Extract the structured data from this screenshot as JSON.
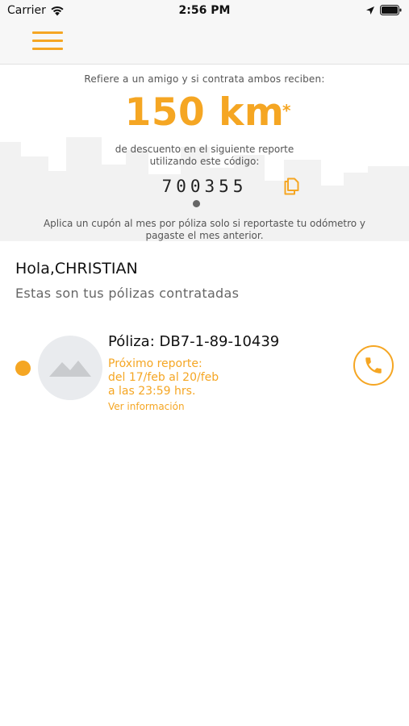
{
  "status_bar": {
    "carrier": "Carrier",
    "time": "2:56 PM"
  },
  "nav": {
    "menu_icon": "hamburger-menu-icon"
  },
  "referral": {
    "intro": "Refiere a un amigo y si contrata ambos reciben:",
    "amount": "150 km",
    "asterisk": "*",
    "description_line1": "de descuento en el siguiente reporte",
    "description_line2": "utilizando este código:",
    "code": "700355",
    "note_line1": "Aplica un cupón al mes por póliza solo si reportaste tu odómetro y",
    "note_line2": "pagaste el mes anterior."
  },
  "greeting": {
    "hello": "Hola,CHRISTIAN",
    "subtitle": "Estas son tus pólizas contratadas"
  },
  "policies": [
    {
      "number": "Póliza: DB7-1-89-10439",
      "next_report_line1": "Próximo reporte:",
      "next_report_line2": "del 17/feb al 20/feb",
      "next_report_line3": "a las 23:59 hrs.",
      "see_info": "Ver información"
    }
  ],
  "colors": {
    "accent": "#f5a623",
    "text": "#222222",
    "muted": "#555555"
  }
}
